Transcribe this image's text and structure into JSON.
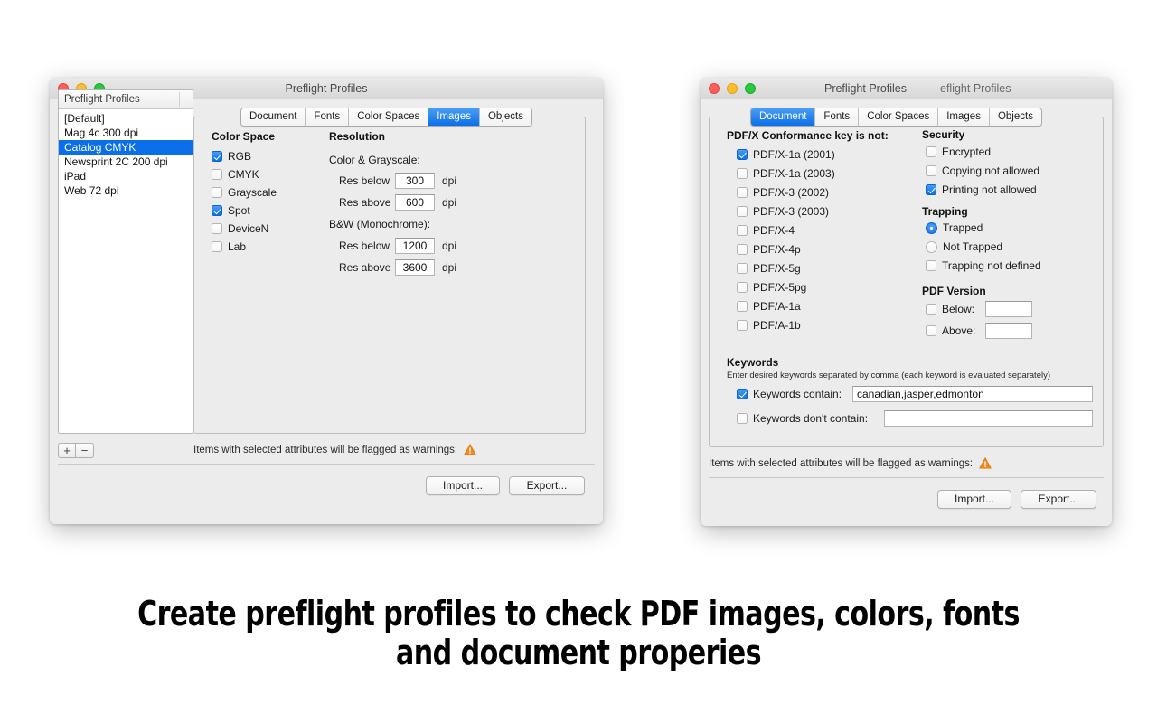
{
  "caption": {
    "line1": "Create preflight profiles to check PDF images, colors, fonts",
    "line2": "and document properies"
  },
  "left_window": {
    "title": "Preflight Profiles",
    "traffic_lights": [
      "close-red",
      "minimize-yellow",
      "zoom-green"
    ],
    "tabs": [
      {
        "label": "Document",
        "active": false
      },
      {
        "label": "Fonts",
        "active": false
      },
      {
        "label": "Color Spaces",
        "active": false
      },
      {
        "label": "Images",
        "active": true
      },
      {
        "label": "Objects",
        "active": false
      }
    ],
    "sidebar": {
      "header": "Preflight Profiles",
      "items": [
        {
          "label": "[Default]",
          "selected": false
        },
        {
          "label": "Mag 4c 300 dpi",
          "selected": false
        },
        {
          "label": "Catalog CMYK",
          "selected": true
        },
        {
          "label": "Newsprint 2C 200 dpi",
          "selected": false
        },
        {
          "label": "iPad",
          "selected": false
        },
        {
          "label": "Web 72 dpi",
          "selected": false
        }
      ],
      "add_label": "+",
      "remove_label": "−"
    },
    "images_panel": {
      "color_space_title": "Color Space",
      "color_space_items": [
        {
          "label": "RGB",
          "checked": true
        },
        {
          "label": "CMYK",
          "checked": false
        },
        {
          "label": "Grayscale",
          "checked": false
        },
        {
          "label": "Spot",
          "checked": true
        },
        {
          "label": "DeviceN",
          "checked": false
        },
        {
          "label": "Lab",
          "checked": false
        }
      ],
      "resolution_title": "Resolution",
      "color_gray_label": "Color & Grayscale:",
      "bw_label": "B&W (Monochrome):",
      "unit": "dpi",
      "fields": [
        {
          "label": "Res below",
          "value": "300"
        },
        {
          "label": "Res above",
          "value": "600"
        },
        {
          "label": "Res below",
          "value": "1200"
        },
        {
          "label": "Res above",
          "value": "3600"
        }
      ]
    },
    "footer": {
      "note": "Items with selected attributes will be flagged as warnings:",
      "import_label": "Import...",
      "export_label": "Export..."
    }
  },
  "right_window": {
    "title": "Preflight Profiles",
    "title_ghost": "eflight Profiles",
    "traffic_lights": [
      "close-red",
      "minimize-yellow",
      "zoom-green"
    ],
    "tabs": [
      {
        "label": "Document",
        "active": true
      },
      {
        "label": "Fonts",
        "active": false
      },
      {
        "label": "Color Spaces",
        "active": false
      },
      {
        "label": "Images",
        "active": false
      },
      {
        "label": "Objects",
        "active": false
      }
    ],
    "document_panel": {
      "conformance_title": "PDF/X Conformance key is not:",
      "conformance_items": [
        {
          "label": "PDF/X-1a (2001)",
          "checked": true
        },
        {
          "label": "PDF/X-1a (2003)",
          "checked": false
        },
        {
          "label": "PDF/X-3 (2002)",
          "checked": false
        },
        {
          "label": "PDF/X-3 (2003)",
          "checked": false
        },
        {
          "label": "PDF/X-4",
          "checked": false
        },
        {
          "label": "PDF/X-4p",
          "checked": false
        },
        {
          "label": "PDF/X-5g",
          "checked": false
        },
        {
          "label": "PDF/X-5pg",
          "checked": false
        },
        {
          "label": "PDF/A-1a",
          "checked": false
        },
        {
          "label": "PDF/A-1b",
          "checked": false
        }
      ],
      "security_title": "Security",
      "security_items": [
        {
          "label": "Encrypted",
          "checked": false
        },
        {
          "label": "Copying not allowed",
          "checked": false
        },
        {
          "label": "Printing not allowed",
          "checked": true
        }
      ],
      "trapping_title": "Trapping",
      "trapping_radios": [
        {
          "label": "Trapped",
          "selected": true
        },
        {
          "label": "Not Trapped",
          "selected": false
        }
      ],
      "trapping_checkbox": {
        "label": "Trapping not defined",
        "checked": false
      },
      "pdf_version_title": "PDF Version",
      "pdf_version_items": [
        {
          "label": "Below:",
          "checked": false,
          "value": ""
        },
        {
          "label": "Above:",
          "checked": false,
          "value": ""
        }
      ],
      "keywords_title": "Keywords",
      "keywords_hint": "Enter desired keywords separated by comma (each keyword is evaluated separately)",
      "keywords_contain": {
        "label": "Keywords contain:",
        "checked": true,
        "value": "canadian,jasper,edmonton"
      },
      "keywords_not_contain": {
        "label": "Keywords don't contain:",
        "checked": false,
        "value": ""
      }
    },
    "footer": {
      "note": "Items with selected attributes will be flagged as warnings:",
      "import_label": "Import...",
      "export_label": "Export..."
    }
  }
}
